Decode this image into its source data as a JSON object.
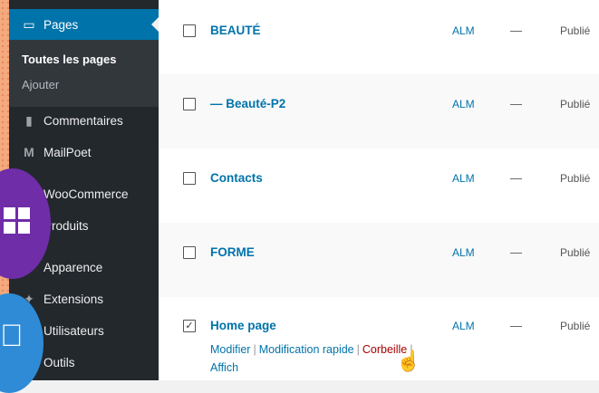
{
  "sidebar": {
    "pages_label": "Pages",
    "submenu": {
      "all_pages": "Toutes les pages",
      "add": "Ajouter"
    },
    "items": [
      {
        "label": "Commentaires"
      },
      {
        "label": "MailPoet"
      },
      {
        "label": "WooCommerce"
      },
      {
        "label": "Produits"
      },
      {
        "label": "Apparence"
      },
      {
        "label": "Extensions"
      },
      {
        "label": "Utilisateurs"
      },
      {
        "label": "Outils"
      }
    ]
  },
  "rows": [
    {
      "title": "BEAUTÉ",
      "author": "ALM",
      "dash": "—",
      "status": "Publié",
      "checked": false
    },
    {
      "title": "— Beauté-P2",
      "author": "ALM",
      "dash": "—",
      "status": "Publié",
      "checked": false
    },
    {
      "title": "Contacts",
      "author": "ALM",
      "dash": "—",
      "status": "Publié",
      "checked": false
    },
    {
      "title": "FORME",
      "author": "ALM",
      "dash": "—",
      "status": "Publié",
      "checked": false
    },
    {
      "title": "Home page",
      "author": "ALM",
      "dash": "—",
      "status": "Publié",
      "checked": true
    }
  ],
  "row_actions": {
    "edit": "Modifier",
    "quick_edit": "Modification rapide",
    "trash": "Corbeille",
    "view": "Affich",
    "separator": "|"
  },
  "checkmark": "✓",
  "colors": {
    "sidebar_bg": "#23282d",
    "accent": "#0073aa",
    "trash": "#a00000"
  }
}
